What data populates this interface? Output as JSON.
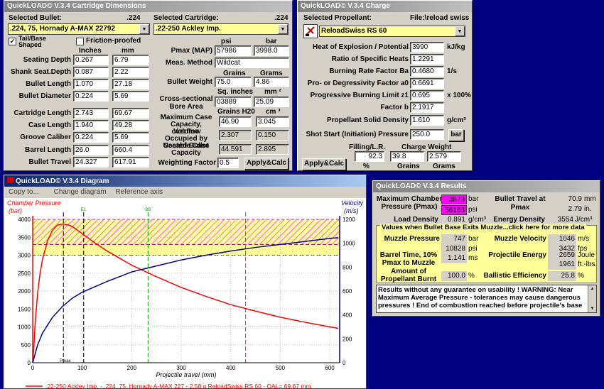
{
  "cart": {
    "title": "QuickLOAD© V.3.4 Cartridge Dimensions",
    "sel_bullet_label": "Selected Bullet:",
    "cal1": ".224",
    "bullet": ".224, 75, Hornady A-MAX 22792",
    "sel_cart_label": "Selected Cartridge:",
    "cal2": ".224",
    "cartridge": ".22-250 Ackley Imp.",
    "tailbase": "Tail/Base Shaped",
    "friction": "Friction-proofed",
    "inches": "Inches",
    "mm": "mm",
    "rows": [
      {
        "label": "Seating Depth",
        "in": "0.267",
        "mm": "6.79"
      },
      {
        "label": "Shank Seat.Depth",
        "in": "0.087",
        "mm": "2.22"
      },
      {
        "label": "Bullet Length",
        "in": "1.070",
        "mm": "27.18"
      },
      {
        "label": "Bullet Diameter",
        "in": "0.224",
        "mm": "5.69"
      },
      {
        "label": "Cartridge Length",
        "in": "2.743",
        "mm": "69.67"
      },
      {
        "label": "Case Length",
        "in": "1.940",
        "mm": "49.28"
      },
      {
        "label": "Groove Caliber",
        "in": "0.224",
        "mm": "5.69"
      },
      {
        "label": "Barrel Length",
        "in": "26.0",
        "mm": "660.4"
      },
      {
        "label": "Bullet Travel",
        "in": "24.327",
        "mm": "617.91"
      }
    ],
    "psi": "psi",
    "bar": "bar",
    "pmax_label": "Pmax (MAP)",
    "pmax_psi": "57986",
    "pmax_bar": "3998.0",
    "meas_label": "Meas. Method",
    "meas": "Wildcat",
    "grains": "Grains",
    "grams": "Grams",
    "bw_label": "Bullet Weight",
    "bw_gr": "75.0",
    "bw_g": "4.86",
    "sqin": "Sq. inches",
    "mm2": "mm ²",
    "bore_label": "Cross-sectional Bore Area",
    "bore_in": "03889",
    "bore_mm": "25.09",
    "grh2o": "Grains H20",
    "cm3": "cm ³",
    "maxcap_label": "Maximum Case Capacity, overflow",
    "maxcap_gr": "46.90",
    "maxcap_cm": "3.045",
    "volocc_label": "Volume Occupied by Seated Bullet",
    "volocc_gr": "2.307",
    "volocc_cm": "0.150",
    "usecap_label": "Useable Case Capacity",
    "usecap_gr": "44.591",
    "usecap_cm": "2.895",
    "wf_label": "Weighting Factor",
    "wf": "0.5",
    "apply": "Apply&Calc"
  },
  "charge": {
    "title": "QuickLOAD© V.3.4 Charge",
    "sel_prop": "Selected Propellant:",
    "file": "File:\\reload swiss",
    "prop": "ReloadSwiss RS 60",
    "rows": [
      {
        "label": "Heat of Explosion / Potential",
        "val": "3990",
        "unit": "kJ/kg"
      },
      {
        "label": "Ratio of Specific Heats",
        "val": "1.2291",
        "unit": ""
      },
      {
        "label": "Burning Rate Factor  Ba",
        "val": "0.4680",
        "unit": "1/s"
      },
      {
        "label": "Pro- or Degressivity Factor  a0",
        "val": "0.6691",
        "unit": ""
      },
      {
        "label": "Progressive Burning Limit z1",
        "val": "0.695",
        "unit": "x 100%"
      },
      {
        "label": "Factor  b",
        "val": "2.1917",
        "unit": ""
      },
      {
        "label": "Propellant Solid Density",
        "val": "1.610",
        "unit": "g/cm³"
      },
      {
        "label": "Shot Start (Initiation) Pressure",
        "val": "250.0",
        "unit": ""
      }
    ],
    "bar_btn": "bar",
    "fill_label": "Filling/L.R.",
    "cw_label": "Charge Weight",
    "fill": "92.3",
    "cw_gr": "39.8",
    "cw_g": "2.579",
    "pct": "%",
    "grains": "Grains",
    "grams": "Grams",
    "apply": "Apply&Calc"
  },
  "diagram": {
    "title": "QuickLOAD© V.3.4 Diagram",
    "menu": [
      "Copy to...",
      "Change diagram",
      "Reference axis"
    ],
    "ylabel_l": "Chamber Pressure",
    "yunit_l": "(bar)",
    "ylabel_r": "Velocity",
    "yunit_r": "(m/s)",
    "xlabel": "Projectile travel (mm)",
    "mark_e1": "E1",
    "mark_bb": "BB",
    "y_left": [
      "0",
      "500",
      "1000",
      "1500",
      "2000",
      "2500",
      "3000",
      "3500",
      "4000"
    ],
    "y_right": [
      "0",
      "200",
      "400",
      "600",
      "800",
      "1000",
      "1200"
    ],
    "x_ticks": [
      "0",
      "100",
      "200",
      "300",
      "400",
      "500",
      "600"
    ],
    "legend": ".22-250 Ackley Imp. - .224, 75, Hornady A-MAX 227 - 2.58 g ReloadSwiss RS 60 - OAL= 69.67 mm",
    "colors": {
      "pressure": "#ff0000",
      "velocity": "#000080",
      "hatch": "#ff00ff",
      "band": "#ffff99"
    }
  },
  "chart_data": {
    "type": "line",
    "xlabel": "Projectile travel (mm)",
    "ylabel": "Chamber Pressure",
    "xlim": [
      0,
      620
    ],
    "ylim": [
      0,
      4000
    ],
    "y2lim": [
      0,
      1200
    ],
    "series": [
      {
        "name": "Chamber Pressure",
        "axis": "left",
        "x": [
          0,
          2,
          5,
          10,
          15,
          20,
          30,
          40,
          50,
          60,
          70,
          80,
          100,
          125,
          150,
          175,
          200,
          250,
          300,
          350,
          400,
          450,
          500,
          550,
          600,
          617
        ],
        "y": [
          0,
          350,
          1100,
          1950,
          2500,
          2900,
          3400,
          3700,
          3840,
          3870,
          3850,
          3800,
          3600,
          3350,
          3120,
          2920,
          2720,
          2400,
          2100,
          1850,
          1620,
          1440,
          1270,
          1130,
          1000,
          960
        ]
      },
      {
        "name": "Velocity",
        "axis": "right",
        "x": [
          0,
          10,
          20,
          40,
          60,
          80,
          100,
          150,
          200,
          250,
          300,
          350,
          400,
          450,
          500,
          550,
          600,
          617
        ],
        "y": [
          0,
          150,
          250,
          380,
          470,
          540,
          590,
          680,
          760,
          810,
          860,
          900,
          935,
          965,
          990,
          1015,
          1040,
          1046
        ]
      }
    ],
    "markers": [
      {
        "x": 62,
        "label": "Pmax"
      },
      {
        "x": 103,
        "label": "E1"
      },
      {
        "x": 233,
        "label": "BB"
      },
      {
        "x": 430,
        "label": ""
      }
    ],
    "grid": true
  },
  "results": {
    "title": "QuickLOAD© V.3.4 Results",
    "mcp_label": "Maximum Chamber Pressure (Pmax)",
    "mcp_bar": "3873",
    "mcp_psi": "56168",
    "bar": "bar",
    "psi": "psi",
    "bt_label": "Bullet Travel at Pmax",
    "bt_mm": "70.9",
    "bt_in": "2.79",
    "mm": "mm",
    "in": "in.",
    "ld_label": "Load Density",
    "ld": "0.891",
    "gcm3": "g/cm³",
    "ed_label": "Energy Density",
    "ed": "3554",
    "jcm3": "J/cm³",
    "muzzle_head": "Values when Bullet Base Exits Muzzle...click here for more data",
    "mp_label": "Muzzle Pressure",
    "mp_bar": "747",
    "mp_psi": "10828",
    "mv_label": "Muzzle Velocity",
    "mv_ms": "1046",
    "mv_fps": "3432",
    "ms": "m/s",
    "fps": "fps",
    "bt2_label": "Barrel Time, 10% Pmax to Muzzle",
    "bt2": "1.141",
    "ms2": "ms",
    "pe_label": "Projectile Energy",
    "pe_j": "2659",
    "pe_ft": "1961",
    "joule": "Joule",
    "ftlbs": "ft.-lbs.",
    "ab_label": "Amount of Propellant Burnt",
    "ab": "100.0",
    "pct": "%",
    "be_label": "Ballistic Efficiency",
    "be": "25.8",
    "warning": "Results without any guarantee on usability !  WARNING: Near Maximum Average Pressure - tolerances may cause dangerous pressures !  End of combustion reached before projectile's base"
  }
}
